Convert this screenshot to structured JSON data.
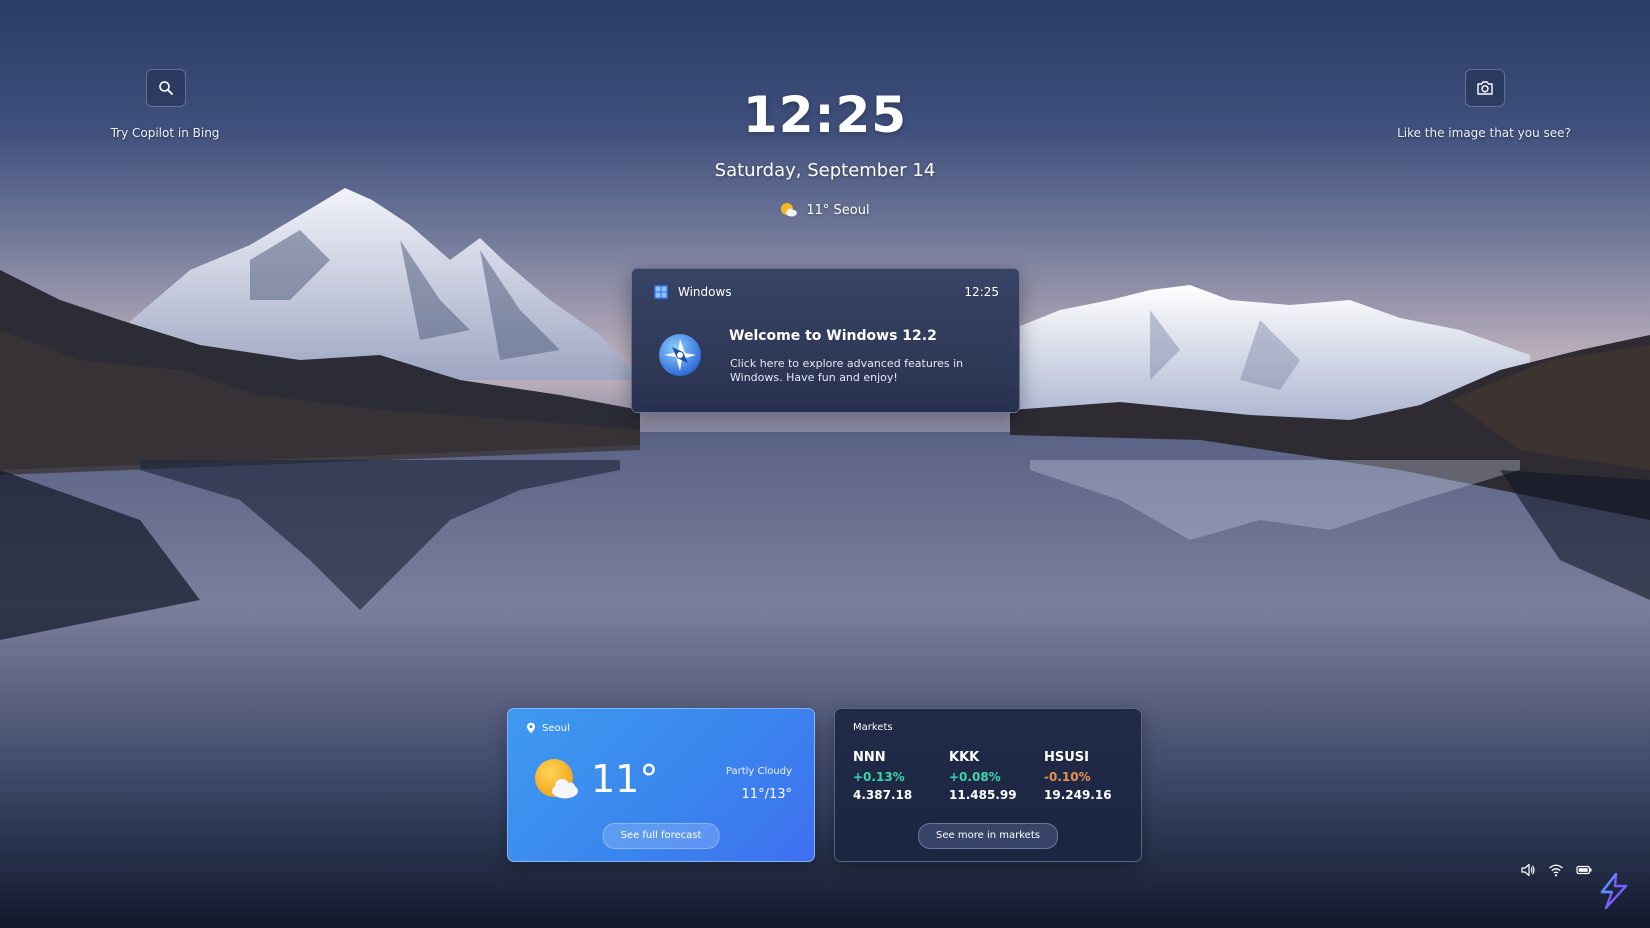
{
  "lock_screen": {
    "time": "12:25",
    "date": "Saturday, September 14",
    "weather_summary": "11° Seoul"
  },
  "corners": {
    "search": {
      "icon": "search-icon",
      "label": "Try Copilot in Bing"
    },
    "spotlight": {
      "icon": "camera-icon",
      "label": "Like the image that you see?"
    }
  },
  "notification": {
    "app_name": "Windows",
    "time": "12:25",
    "title": "Welcome to Windows 12.2",
    "body": "Click here to explore advanced features in Windows. Have fun and enjoy!",
    "app_icon": "windows-logo-icon",
    "body_icon": "compass-icon"
  },
  "weather_widget": {
    "location": "Seoul",
    "temperature": "11°",
    "condition": "Partly Cloudy",
    "range": "11°/13°",
    "button_label": "See full forecast",
    "icon": "partly-cloudy-icon"
  },
  "markets_widget": {
    "title": "Markets",
    "stocks": [
      {
        "symbol": "NNN",
        "change": "+0.13%",
        "price": "4.387.18"
      },
      {
        "symbol": "KKK",
        "change": "+0.08%",
        "price": "11.485.99"
      },
      {
        "symbol": "HSUSI",
        "change": "-0.10%",
        "price": "19.249.16"
      }
    ],
    "button_label": "See more in markets"
  },
  "system_tray": {
    "icons": [
      "volume-icon",
      "wifi-icon",
      "battery-icon"
    ]
  },
  "colors": {
    "positive": "#3fd6a8",
    "negative": "#e8934f",
    "weather_card": "#3a86ee",
    "sun": "#f6b81f"
  }
}
